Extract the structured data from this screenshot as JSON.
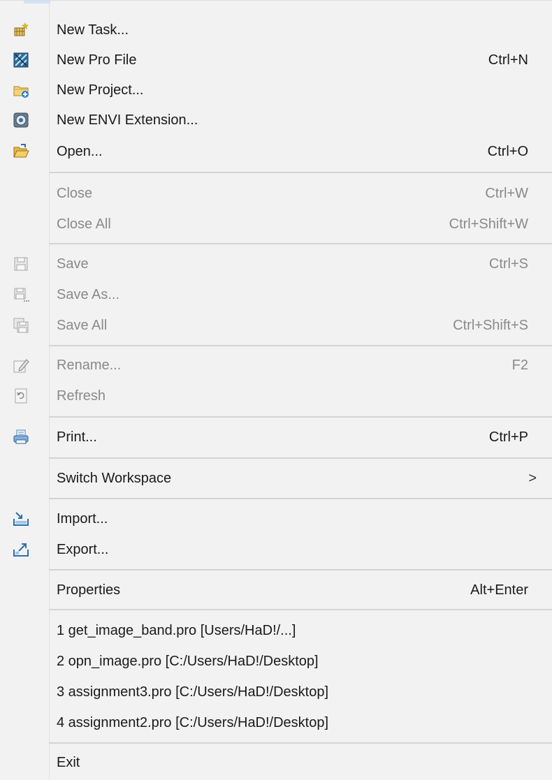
{
  "menu": {
    "new_task": {
      "label": "New Task..."
    },
    "new_pro_file": {
      "label": "New Pro File",
      "accel": "Ctrl+N"
    },
    "new_project": {
      "label": "New Project..."
    },
    "new_envi_extension": {
      "label": "New ENVI Extension..."
    },
    "open": {
      "label": "Open...",
      "accel": "Ctrl+O"
    },
    "close": {
      "label": "Close",
      "accel": "Ctrl+W"
    },
    "close_all": {
      "label": "Close All",
      "accel": "Ctrl+Shift+W"
    },
    "save": {
      "label": "Save",
      "accel": "Ctrl+S"
    },
    "save_as": {
      "label": "Save As..."
    },
    "save_all": {
      "label": "Save All",
      "accel": "Ctrl+Shift+S"
    },
    "rename": {
      "label": "Rename...",
      "accel": "F2"
    },
    "refresh": {
      "label": "Refresh"
    },
    "print": {
      "label": "Print...",
      "accel": "Ctrl+P"
    },
    "switch_workspace": {
      "label": "Switch Workspace",
      "arrow": ">"
    },
    "import": {
      "label": "Import..."
    },
    "export": {
      "label": "Export..."
    },
    "properties": {
      "label": "Properties",
      "accel": "Alt+Enter"
    },
    "recent_files": [
      {
        "label": "1 get_image_band.pro  [Users/HaD!/...]"
      },
      {
        "label": "2 opn_image.pro  [C:/Users/HaD!/Desktop]"
      },
      {
        "label": "3 assignment3.pro  [C:/Users/HaD!/Desktop]"
      },
      {
        "label": "4 assignment2.pro  [C:/Users/HaD!/Desktop]"
      }
    ],
    "exit": {
      "label": "Exit"
    }
  },
  "icons": {
    "new_task": "new-task-icon",
    "new_pro_file": "pro-file-icon",
    "new_project": "new-project-icon",
    "new_envi_extension": "envi-extension-icon",
    "open": "open-folder-icon",
    "save": "save-icon",
    "save_as": "save-as-icon",
    "save_all": "save-all-icon",
    "rename": "rename-icon",
    "refresh": "refresh-icon",
    "print": "print-icon",
    "import": "import-icon",
    "export": "export-icon"
  },
  "colors": {
    "background": "#f2f2f2",
    "text": "#1a1a1a",
    "disabled_text": "#8a8a8a",
    "separator": "#d4d4d4"
  }
}
